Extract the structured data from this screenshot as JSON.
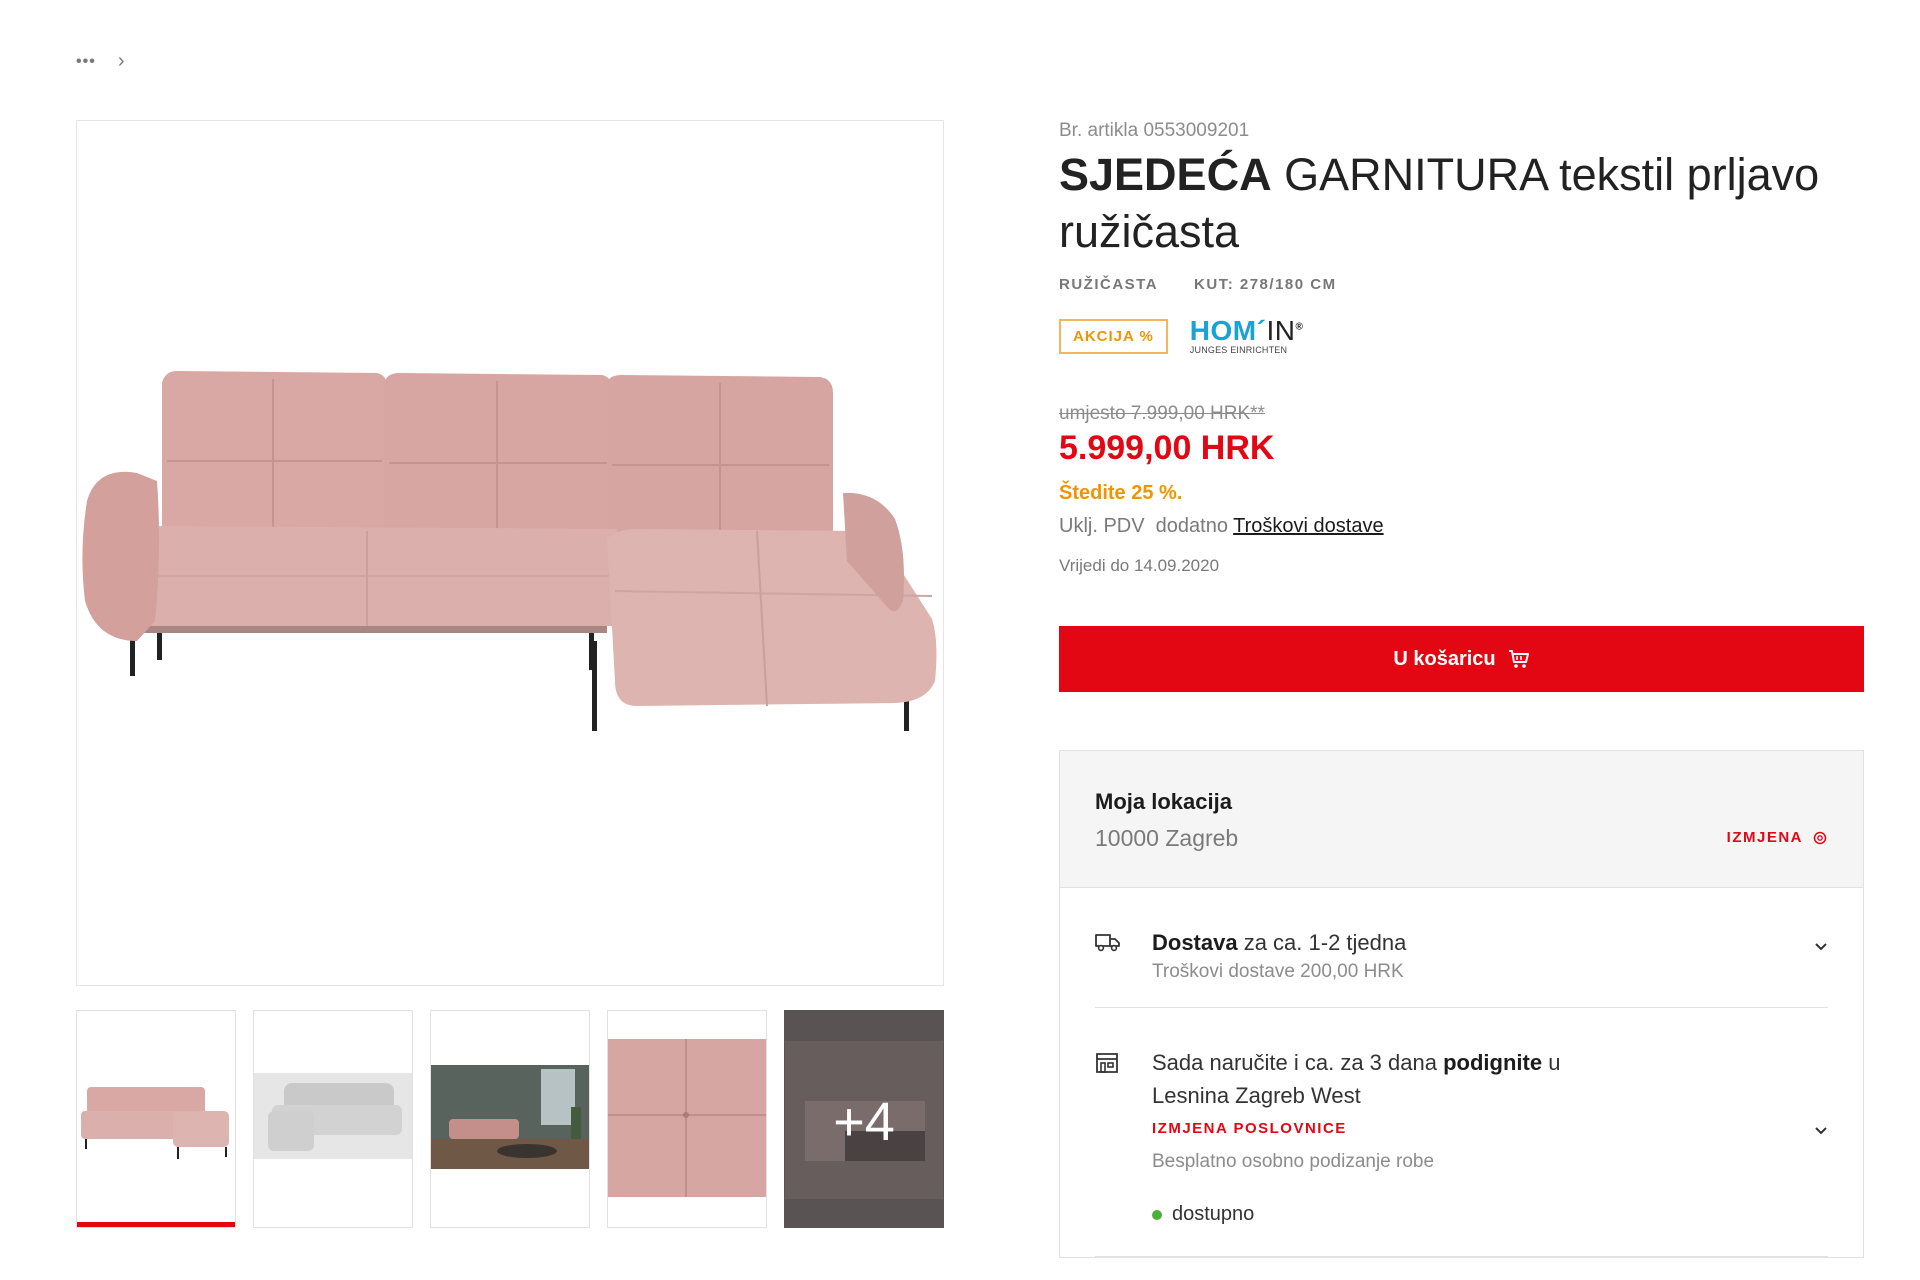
{
  "breadcrumb": {
    "more": "•••",
    "separator": "›"
  },
  "product": {
    "article_number": "Br. artikla 0553009201",
    "title_bold": "SJEDEĆA",
    "title_rest": " GARNITURA tekstil prljavo ružičasta",
    "color": "RUŽIČASTA",
    "size": "KUT: 278/180 CM",
    "badge": "AKCIJA %",
    "brand": {
      "main": "HOM´",
      "suffix": "IN",
      "mark": "®",
      "tagline": "JUNGES EINRICHTEN"
    }
  },
  "pricing": {
    "old_price": "umjesto 7.999,00 HRK**",
    "price": "5.999,00 HRK",
    "saving": "Štedite 25 %.",
    "vat_text": "Uklj. PDV  dodatno ",
    "shipping_link": "Troškovi dostave",
    "valid_until": "Vrijedi do 14.09.2020"
  },
  "cart_button": {
    "label": "U košaricu",
    "icon": "cart-icon"
  },
  "location": {
    "title": "Moja lokacija",
    "city": "10000 Zagreb",
    "change": "IZMJENA"
  },
  "delivery": {
    "bold": "Dostava",
    "text": " za ca. 1-2 tjedna",
    "sub": "Troškovi dostave 200,00 HRK"
  },
  "pickup": {
    "text_a": "Sada naručite i ca. za 3 dana ",
    "bold": "podignite",
    "text_b": " u",
    "store": "Lesnina Zagreb West",
    "change": "IZMJENA POSLOVNICE",
    "sub": "Besplatno osobno podizanje robe",
    "availability": "dostupno"
  },
  "gallery": {
    "more_label": "+4"
  },
  "colors": {
    "accent": "#e30613",
    "orange": "#f29400",
    "brand_blue": "#19a2d6",
    "sofa": "#d9a7a4",
    "available": "#4caf3a"
  }
}
